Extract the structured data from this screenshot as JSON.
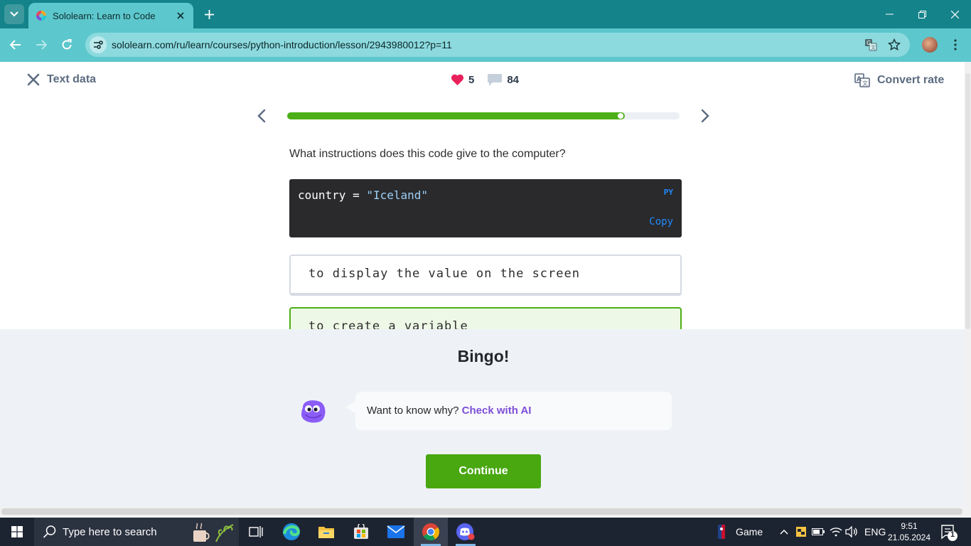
{
  "browser": {
    "tab_title": "Sololearn: Learn to Code",
    "url": "sololearn.com/ru/learn/courses/python-introduction/lesson/2943980012?p=11"
  },
  "lesson": {
    "close_label": "Text data",
    "hearts": "5",
    "comments": "84",
    "convert_label": "Convert rate",
    "progress_fraction": 0.86,
    "question": "What instructions does this code give to the computer?",
    "code": {
      "variable": "country",
      "operator": " = ",
      "string": "\"Iceland\"",
      "lang": "PY",
      "copy_label": "Copy"
    },
    "options": [
      {
        "text": "to display the value on the screen",
        "state": "neutral"
      },
      {
        "text": "to create a variable",
        "state": "correct"
      }
    ]
  },
  "feedback": {
    "title": "Bingo!",
    "why_text": "Want to know why?",
    "ai_link": "Check with AI",
    "continue_label": "Continue"
  },
  "taskbar": {
    "search_placeholder": "Type here to search",
    "game_label": "Game",
    "language": "ENG",
    "time": "9:51",
    "date": "21.05.2024",
    "notification_count": "1"
  },
  "colors": {
    "tab_bar": "#14838a",
    "toolbar": "#5cc7cc",
    "accent_green": "#4caf17",
    "continue_green": "#49a710",
    "link_purple": "#7d4ed8",
    "code_bg": "#2a2a2c"
  },
  "icons": [
    "tab-list-icon",
    "sololearn-favicon",
    "close-tab-icon",
    "new-tab-icon",
    "minimize-icon",
    "restore-icon",
    "close-window-icon",
    "back-icon",
    "forward-icon",
    "reload-icon",
    "site-info-icon",
    "translate-icon",
    "bookmark-star-icon",
    "kebab-menu-icon",
    "close-x-icon",
    "heart-icon",
    "comment-icon",
    "translate-page-icon",
    "chevron-left-icon",
    "chevron-right-icon",
    "windows-start-icon",
    "search-icon",
    "task-view-icon",
    "edge-icon",
    "file-explorer-icon",
    "store-icon",
    "mail-icon",
    "chrome-icon",
    "discord-icon",
    "nba-icon",
    "chevron-up-icon",
    "vpn-shield-icon",
    "battery-icon",
    "wifi-icon",
    "volume-icon",
    "notification-icon"
  ]
}
